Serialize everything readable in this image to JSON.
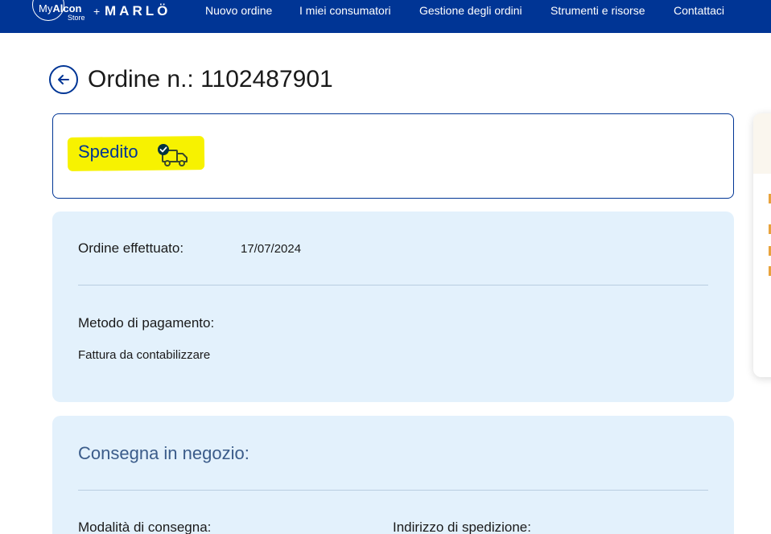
{
  "header": {
    "logo_my": "My",
    "logo_alcon": "Alcon",
    "logo_store": "Store",
    "logo_plus": "+",
    "logo_marlo": "MARLÖ",
    "nav": [
      {
        "label": "Nuovo ordine"
      },
      {
        "label": "I miei consumatori"
      },
      {
        "label": "Gestione degli ordini"
      },
      {
        "label": "Strumenti e risorse"
      },
      {
        "label": "Contattaci"
      }
    ]
  },
  "order": {
    "title": "Ordine n.: 1102487901",
    "status": "Spedito",
    "status_icon": "truck-check-icon"
  },
  "info": {
    "order_placed_label": "Ordine effettuato:",
    "order_placed_value": "17/07/2024",
    "payment_label": "Metodo di pagamento:",
    "payment_value": "Fattura da contabilizzare"
  },
  "delivery": {
    "title": "Consegna in negozio:",
    "mode_label": "Modalità di consegna:",
    "address_label": "Indirizzo di spedizione:"
  },
  "colors": {
    "brand": "#003595",
    "highlight": "#f7f200",
    "card_bg": "#e3f1fc"
  }
}
